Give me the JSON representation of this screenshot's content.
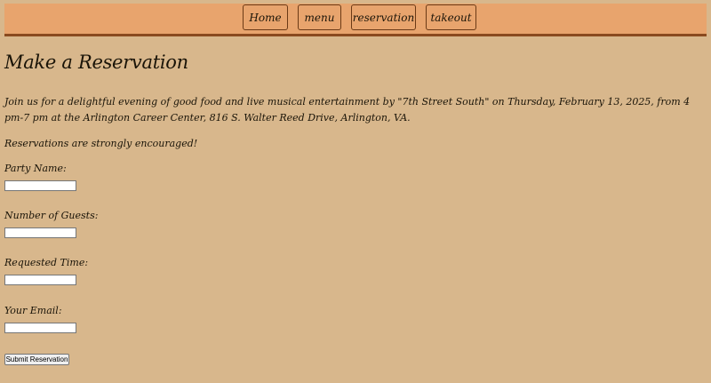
{
  "nav": {
    "items": [
      {
        "label": "Home"
      },
      {
        "label": "menu"
      },
      {
        "label": "reservation"
      },
      {
        "label": "takeout"
      }
    ]
  },
  "page": {
    "title": "Make a Reservation",
    "intro": "Join us for a delightful evening of good food and live musical entertainment by \"7th Street South\" on Thursday, February 13, 2025, from 4 pm-7 pm at the Arlington Career Center, 816 S. Walter Reed Drive, Arlington, VA.",
    "encourage": "Reservations are strongly encouraged!"
  },
  "form": {
    "fields": [
      {
        "label": "Party Name:",
        "value": ""
      },
      {
        "label": "Number of Guests:",
        "value": ""
      },
      {
        "label": "Requested Time:",
        "value": ""
      },
      {
        "label": "Your Email:",
        "value": ""
      }
    ],
    "submit_label": "Submit Reservation"
  }
}
